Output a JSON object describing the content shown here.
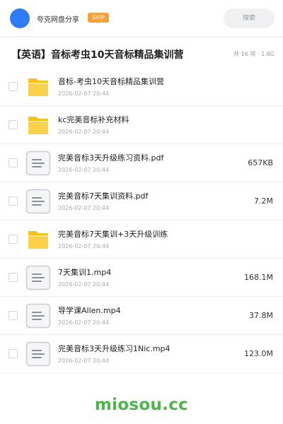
{
  "app": {
    "name": "夸克网盘分享",
    "badge": "SVIP"
  },
  "search": {
    "placeholder": "搜索"
  },
  "header": {
    "title": "【英语】音标考虫10天音标精品集训营",
    "summary": "共 16 项 · 1.6G"
  },
  "files": [
    {
      "type": "folder",
      "icon": "folder-icon",
      "name": "音标-考虫10天音标精品集训营",
      "date": "2026-02-07 20:44",
      "size": ""
    },
    {
      "type": "folder",
      "icon": "folder-icon",
      "name": "kc完美音标补充材料",
      "date": "2026-02-07 20:44",
      "size": ""
    },
    {
      "type": "file",
      "icon": "document-icon",
      "name": "完美音标3天升级练习资料.pdf",
      "date": "2026-02-07 20:44",
      "size": "657KB"
    },
    {
      "type": "file",
      "icon": "document-icon",
      "name": "完美音标7天集训资料.pdf",
      "date": "2026-02-07 20:44",
      "size": "7.2M"
    },
    {
      "type": "folder",
      "icon": "folder-icon",
      "name": "完美音标7天集训+3天升级训练",
      "date": "2026-02-07 20:44",
      "size": ""
    },
    {
      "type": "file",
      "icon": "document-icon",
      "name": "7天集训1.mp4",
      "date": "2026-02-07 20:44",
      "size": "168.1M"
    },
    {
      "type": "file",
      "icon": "document-icon",
      "name": "导学课Allen.mp4",
      "date": "2026-02-07 20:44",
      "size": "37.8M"
    },
    {
      "type": "file",
      "icon": "document-icon",
      "name": "完美音标3天升级练习1Nic.mp4",
      "date": "2026-02-07 20:44",
      "size": "123.0M"
    }
  ],
  "watermark": "miosou.cc",
  "colors": {
    "accent": "#2f7bf6",
    "vip": "#f4a13a",
    "folder": "#f9c21b",
    "watermark": "#4cb648"
  }
}
